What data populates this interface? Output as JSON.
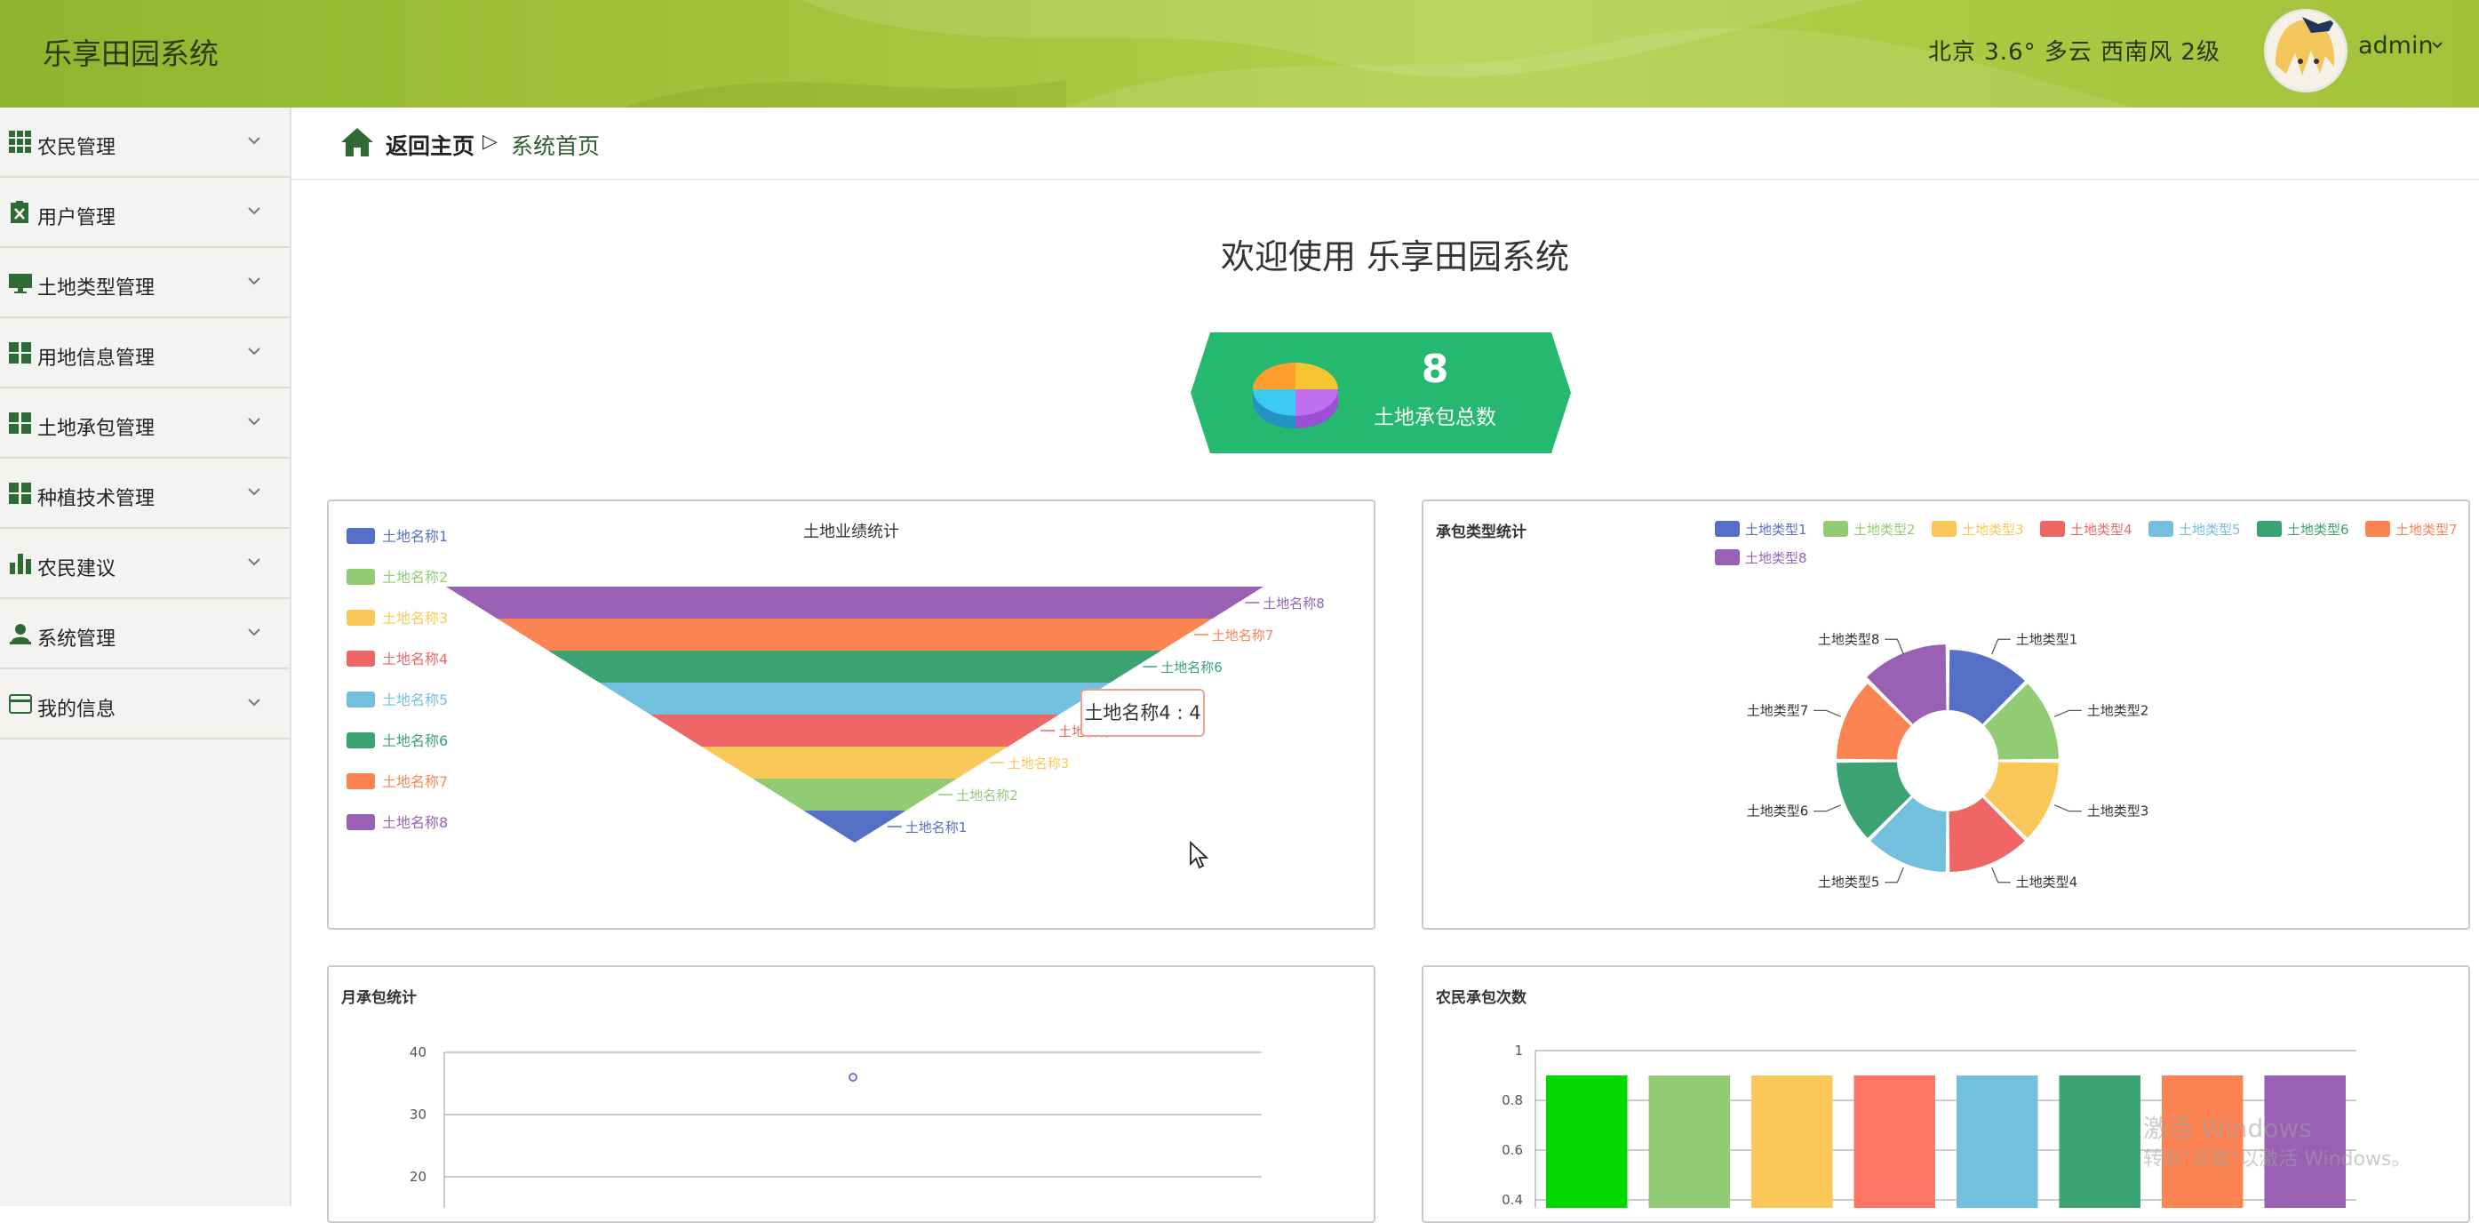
{
  "header": {
    "app_title": "乐享田园系统",
    "weather": "北京  3.6°  多云  西南风  2级",
    "user_name": "admin"
  },
  "sidebar": {
    "items": [
      {
        "label": "农民管理",
        "icon": "grid-icon"
      },
      {
        "label": "用户管理",
        "icon": "excel-icon"
      },
      {
        "label": "土地类型管理",
        "icon": "monitor-icon"
      },
      {
        "label": "用地信息管理",
        "icon": "dashboard-icon"
      },
      {
        "label": "土地承包管理",
        "icon": "dashboard-icon"
      },
      {
        "label": "种植技术管理",
        "icon": "dashboard-icon"
      },
      {
        "label": "农民建议",
        "icon": "bar-chart-icon"
      },
      {
        "label": "系统管理",
        "icon": "user-icon"
      },
      {
        "label": "我的信息",
        "icon": "card-icon"
      }
    ]
  },
  "breadcrumb": {
    "home": "返回主页",
    "separator": "▷",
    "current": "系统首页"
  },
  "welcome": "欢迎使用 乐享田园系统",
  "stat": {
    "value": "8",
    "label": "土地承包总数"
  },
  "colors": {
    "header": "#a5c43d",
    "stat_card": "#24b96f",
    "series": [
      "#5470c6",
      "#91cc75",
      "#fac858",
      "#ee6666",
      "#73c0de",
      "#3ba272",
      "#fc8452",
      "#9a60b4"
    ]
  },
  "tooltip": "土地名称4 : 4",
  "watermark": {
    "line1": "激活 Windows",
    "line2": "转到\"设置\"以激活 Windows。"
  },
  "chart_data": [
    {
      "type": "funnel",
      "title": "土地业绩统计",
      "categories": [
        "土地名称1",
        "土地名称2",
        "土地名称3",
        "土地名称4",
        "土地名称5",
        "土地名称6",
        "土地名称7",
        "土地名称8"
      ],
      "values": [
        1,
        2,
        3,
        4,
        5,
        6,
        7,
        8
      ],
      "legend": "left-vertical"
    },
    {
      "type": "pie",
      "title": "承包类型统计",
      "categories": [
        "土地类型1",
        "土地类型2",
        "土地类型3",
        "土地类型4",
        "土地类型5",
        "土地类型6",
        "土地类型7",
        "土地类型8"
      ],
      "values": [
        1,
        1,
        1,
        1,
        1,
        1,
        1,
        1
      ],
      "donut": true,
      "legend": "top-right"
    },
    {
      "type": "scatter",
      "title": "月承包统计",
      "y_ticks": [
        "40",
        "30",
        "20"
      ],
      "points": [
        {
          "y": 36
        }
      ]
    },
    {
      "type": "bar",
      "title": "农民承包次数",
      "y_ticks": [
        "1",
        "0.8",
        "0.6",
        "0.4"
      ],
      "values": [
        0.9,
        0.9,
        0.9,
        0.9,
        0.9,
        0.9,
        0.9,
        0.9
      ]
    }
  ]
}
